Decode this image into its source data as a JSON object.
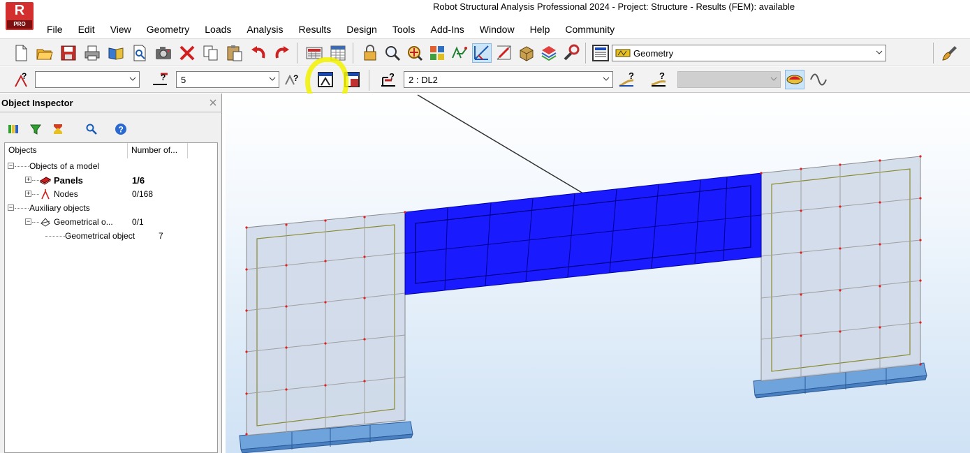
{
  "window": {
    "title": "Robot Structural Analysis Professional 2024 - Project: Structure - Results (FEM): available",
    "logo_letter": "R",
    "logo_sub": "PRO"
  },
  "menu": [
    "File",
    "Edit",
    "View",
    "Geometry",
    "Loads",
    "Analysis",
    "Results",
    "Design",
    "Tools",
    "Add-Ins",
    "Window",
    "Help",
    "Community"
  ],
  "toolbar": {
    "layout_selector_value": "Geometry",
    "icons": [
      "new-icon",
      "open-icon",
      "save-icon",
      "print-icon",
      "book-icon",
      "print-preview-icon",
      "screen-capture-icon",
      "delete-icon",
      "copy-icon",
      "paste-icon",
      "undo-icon",
      "redo-icon",
      "calculator-icon",
      "tables-icon",
      "lock-icon",
      "zoom-icon",
      "zoom-window-icon",
      "display-icon",
      "spring-icon",
      "section-icon",
      "structure-view-icon",
      "object-icon",
      "layers-icon",
      "preferences-icon",
      "layout-icon",
      "brush-icon"
    ]
  },
  "selection_bar": {
    "node_selection_value": "",
    "bar_selection_value": "5",
    "load_case_value": "2 : DL2",
    "load_value_disabled": ""
  },
  "inspector": {
    "title": "Object Inspector",
    "columns": [
      "Objects",
      "Number of..."
    ],
    "rows": [
      {
        "label": "Objects of a model",
        "count": ""
      },
      {
        "label": "Panels",
        "count": "1/6"
      },
      {
        "label": "Nodes",
        "count": "0/168"
      },
      {
        "label": "Auxiliary objects",
        "count": ""
      },
      {
        "label": "Geometrical o...",
        "count": "0/1"
      },
      {
        "label": "Geometrical object",
        "count": "7"
      }
    ]
  },
  "colors": {
    "selected_panel": "#1a1aff",
    "panel": "#cfd8e8",
    "support": "#6fa3dc",
    "highlight": "#f2f200"
  }
}
